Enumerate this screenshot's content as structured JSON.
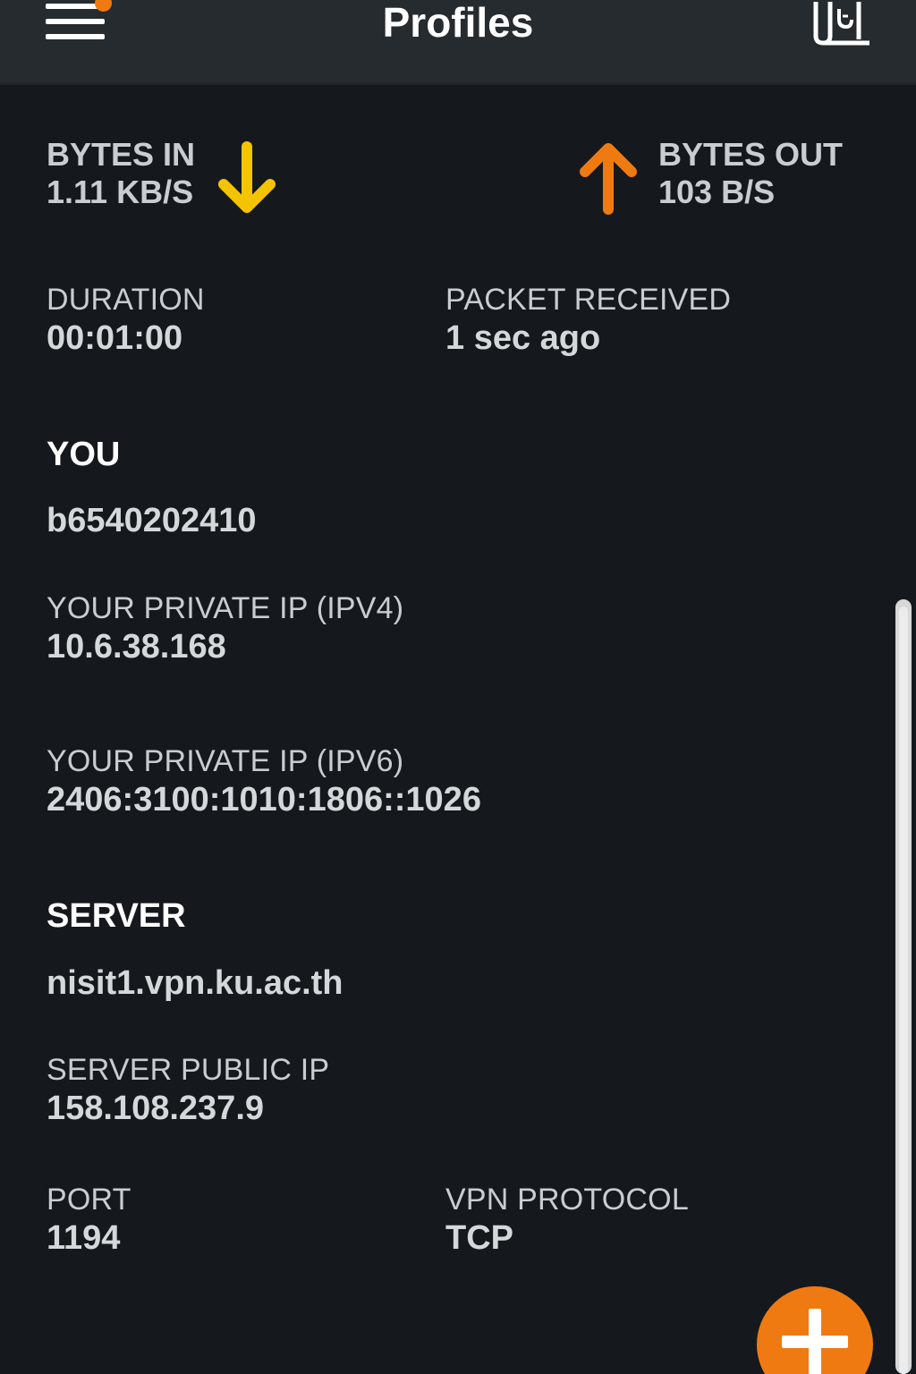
{
  "header": {
    "title": "Profiles",
    "menu_icon": "hamburger-menu-icon",
    "log_icon": "log-document-icon",
    "notification_color": "#f07a12"
  },
  "traffic": {
    "bytes_in_label": "BYTES IN",
    "bytes_in_value": "1.11 KB/S",
    "bytes_in_color": "#f5c400",
    "bytes_out_label": "BYTES OUT",
    "bytes_out_value": "103 B/S",
    "bytes_out_color": "#f07a12"
  },
  "session": {
    "duration_label": "DURATION",
    "duration_value": "00:01:00",
    "packet_label": "PACKET RECEIVED",
    "packet_value": "1 sec ago"
  },
  "you": {
    "section_title": "YOU",
    "username": "b6540202410",
    "ipv4_label": "YOUR PRIVATE IP (IPV4)",
    "ipv4_value": "10.6.38.168",
    "ipv6_label": "YOUR PRIVATE IP (IPV6)",
    "ipv6_value": "2406:3100:1010:1806::1026"
  },
  "server": {
    "section_title": "SERVER",
    "hostname": "nisit1.vpn.ku.ac.th",
    "public_ip_label": "SERVER PUBLIC IP",
    "public_ip_value": "158.108.237.9",
    "port_label": "PORT",
    "port_value": "1194",
    "protocol_label": "VPN PROTOCOL",
    "protocol_value": "TCP"
  },
  "fab": {
    "icon": "plus-icon",
    "color": "#f07a12"
  }
}
